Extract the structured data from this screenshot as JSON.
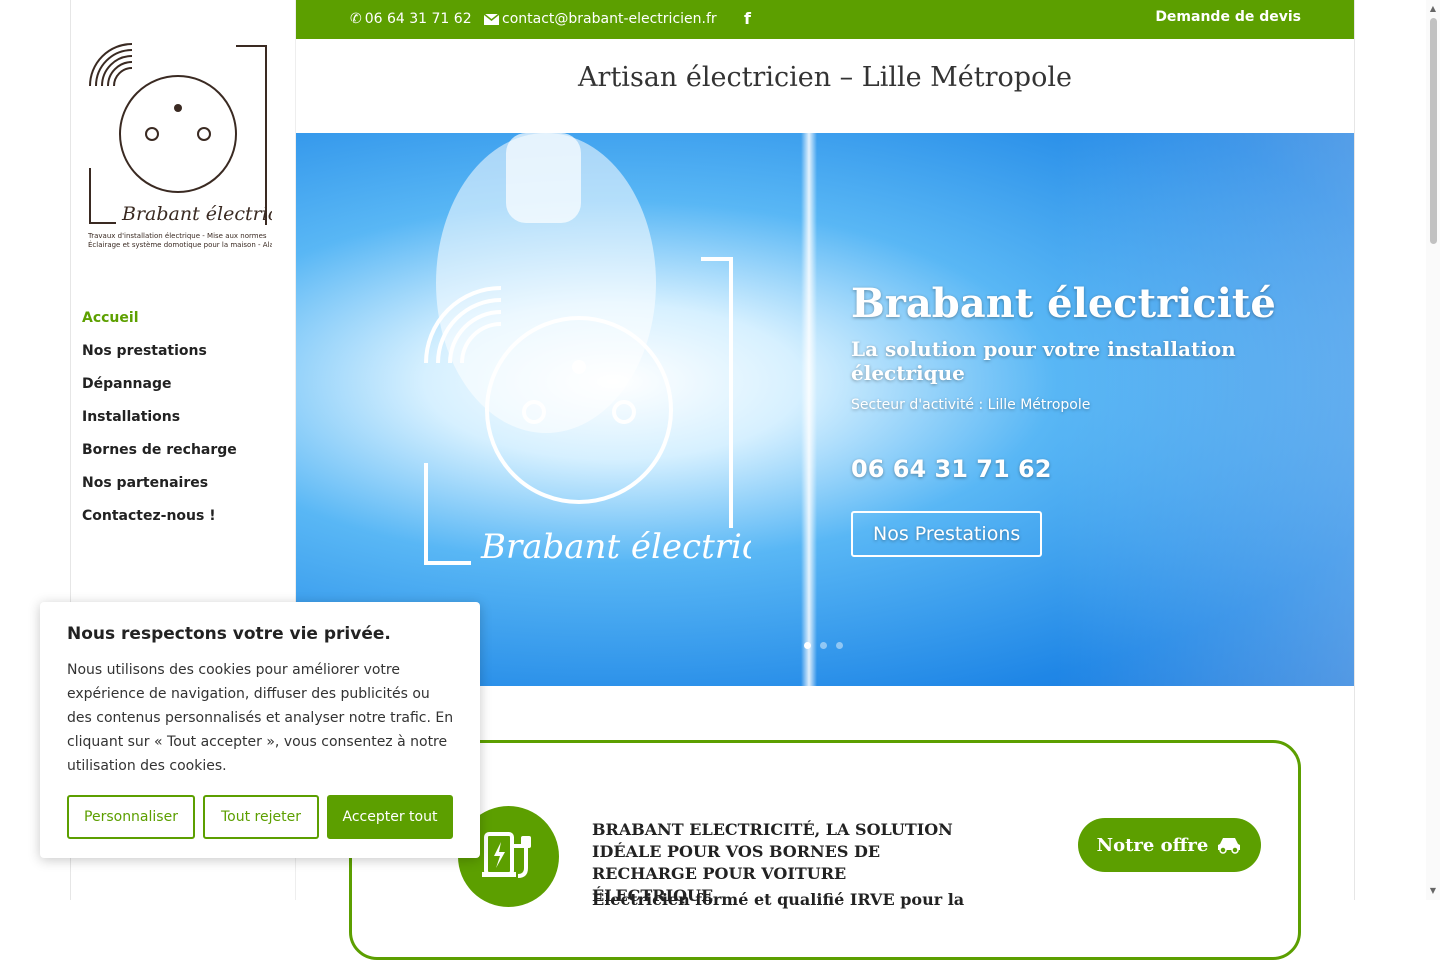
{
  "topbar": {
    "phone": "06 64 31 71 62",
    "email": "contact@brabant-electricien.fr",
    "quote_label": "Demande de devis"
  },
  "site_title": "Artisan électricien – Lille Métropole",
  "logo": {
    "brand": "Brabant électricité",
    "tagline_line1": "Travaux d'installation électrique - Mise aux normes",
    "tagline_line2": "Éclairage et système domotique pour la maison - Alarme"
  },
  "nav": {
    "items": [
      {
        "label": "Accueil",
        "active": true
      },
      {
        "label": "Nos prestations"
      },
      {
        "label": "Dépannage"
      },
      {
        "label": "Installations"
      },
      {
        "label": "Bornes de recharge"
      },
      {
        "label": "Nos partenaires"
      },
      {
        "label": "Contactez-nous !"
      }
    ]
  },
  "hero": {
    "title": "Brabant électricité",
    "subtitle": "La solution pour votre installation électrique",
    "area": "Secteur d'activité : Lille Métropole",
    "phone": "06 64 31 71 62",
    "button_label": "Nos Prestations",
    "logo_text": "Brabant électricité",
    "active_slide": 1,
    "slide_count": 3
  },
  "promo": {
    "title": "BRABANT ELECTRICITÉ, LA SOLUTION IDÉALE POUR VOS BORNES DE RECHARGE POUR VOITURE ÉLECTRIQUE",
    "next_line": "Electricien formé et qualifié IRVE pour la",
    "button_label": "Notre offre",
    "icon": "ev-charger-icon"
  },
  "cookie": {
    "title": "Nous respectons votre vie privée.",
    "body": "Nous utilisons des cookies pour améliorer votre expérience de navigation, diffuser des publicités ou des contenus personnalisés et analyser notre trafic. En cliquant sur « Tout accepter », vous consentez à notre utilisation des cookies.",
    "customize_label": "Personnaliser",
    "reject_label": "Tout rejeter",
    "accept_label": "Accepter tout"
  },
  "colors": {
    "brand_green": "#5c9f00",
    "hero_blue": "#1f86e6"
  }
}
